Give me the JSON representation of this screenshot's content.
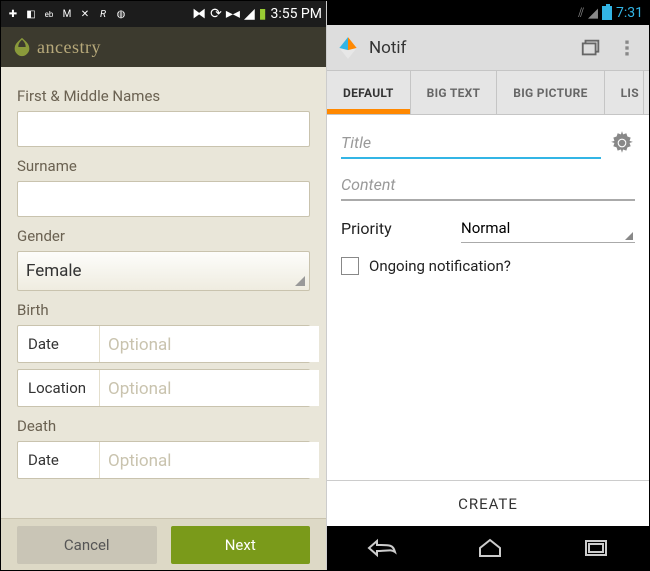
{
  "left": {
    "status": {
      "time": "3:55 PM"
    },
    "header": {
      "brand": "ancestry"
    },
    "form": {
      "firstNamesLabel": "First & Middle Names",
      "surnameLabel": "Surname",
      "genderLabel": "Gender",
      "genderValue": "Female",
      "birthLabel": "Birth",
      "birthDateLabel": "Date",
      "birthDatePlaceholder": "Optional",
      "birthLocationLabel": "Location",
      "birthLocationPlaceholder": "Optional",
      "deathLabel": "Death",
      "deathDateLabel": "Date",
      "deathDatePlaceholder": "Optional"
    },
    "footer": {
      "cancel": "Cancel",
      "next": "Next"
    }
  },
  "right": {
    "status": {
      "time": "7:31"
    },
    "actionbar": {
      "title": "Notif"
    },
    "tabs": {
      "default": "DEFAULT",
      "bigtext": "BIG TEXT",
      "bigpicture": "BIG PICTURE",
      "list": "LIS"
    },
    "content": {
      "titlePlaceholder": "Title",
      "contentPlaceholder": "Content",
      "priorityLabel": "Priority",
      "priorityValue": "Normal",
      "ongoingLabel": "Ongoing notification?"
    },
    "create": "CREATE"
  }
}
